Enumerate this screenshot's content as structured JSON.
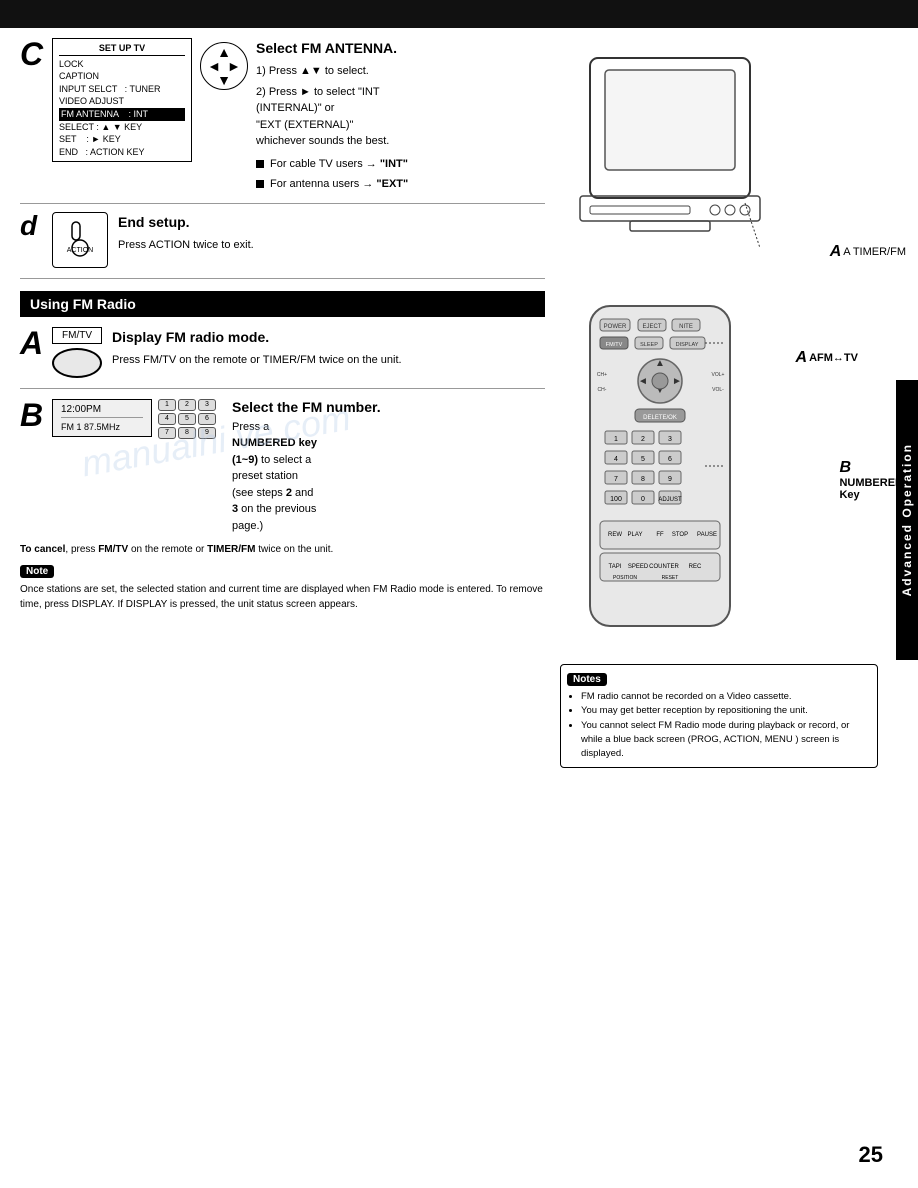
{
  "page": {
    "number": "25",
    "top_bar": true
  },
  "section_c": {
    "letter": "C",
    "title": "Select FM ANTENNA.",
    "menu": {
      "title": "SET UP TV",
      "items": [
        "LOCK",
        "CAPTION",
        "INPUT SELCT   : TUNER",
        "VIDEO ADJUST",
        "FM ANTENNA    : INT",
        "SELECT : ▲ ▼ KEY",
        "SET    : ► KEY",
        "END    : ACTION KEY"
      ],
      "highlighted": "FM ANTENNA    : INT"
    },
    "steps": [
      "1) Press ▲▼ to select.",
      "2) Press ► to select \"INT (INTERNAL)\" or \"EXT (EXTERNAL)\" whichever sounds the best."
    ],
    "bullets": [
      "For cable TV users → \"INT\"",
      "For antenna users → \"EXT\""
    ]
  },
  "section_d": {
    "letter": "d",
    "title": "End setup.",
    "description": "Press ACTION twice to exit."
  },
  "tv_image": {
    "timer_fm_label": "A TIMER/FM"
  },
  "fm_radio_section": {
    "header": "Using FM Radio",
    "section_a": {
      "letter": "A",
      "title": "Display FM radio mode.",
      "button_label": "FM/TV",
      "description": "Press FM/TV on the remote or TIMER/FM twice on the unit.",
      "remote_label": "AFM↔TV"
    },
    "section_b": {
      "letter": "B",
      "title": "Select the FM number.",
      "display": {
        "time": "12:00PM",
        "station": "FM 1  87.5MHz"
      },
      "instruction": "Press a NUMBERED key (1~9) to select a preset station (see steps 2 and 3 on the previous page.)",
      "cancel_note": "To cancel, press FM/TV on the remote or TIMER/FM twice on the unit.",
      "remote_label": "B\nNUMBERED\nKey"
    }
  },
  "note": {
    "label": "Note",
    "text": "Once stations are set, the selected station and current time are displayed when FM Radio mode is entered. To remove time, press DISPLAY. If DISPLAY is pressed, the unit status screen appears."
  },
  "notes_right": {
    "label": "Notes",
    "items": [
      "FM radio cannot be recorded on a Video cassette.",
      "You may get better reception by repositioning the unit.",
      "You cannot select FM Radio mode during playback or record, or while a blue back screen (PROG, ACTION, MENU ) screen is displayed."
    ]
  },
  "sidebar": {
    "label": "Advanced Operation"
  },
  "watermark": "manualhi ve.com"
}
